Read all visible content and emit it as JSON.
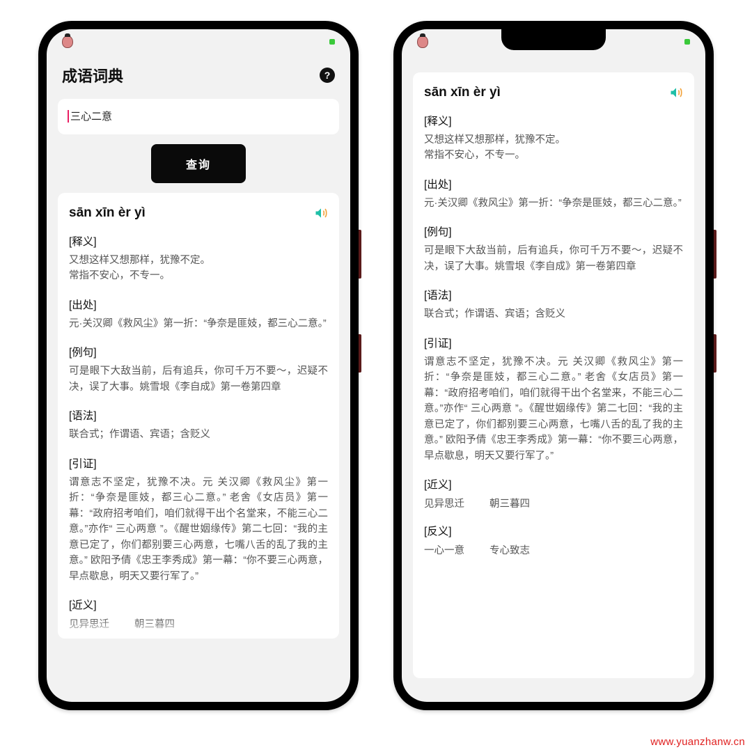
{
  "watermark": "www.yuanzhanw.cn",
  "left": {
    "app_title": "成语词典",
    "search_value": "三心二意",
    "query_label": "查询",
    "pinyin": "sān xīn èr yì",
    "sections": {
      "def_label": "[释义]",
      "def_body": "又想这样又想那样，犹豫不定。\n常指不安心，不专一。",
      "src_label": "[出处]",
      "src_body": "元·关汉卿《救风尘》第一折：“争奈是匪妓，都三心二意。”",
      "ex_label": "[例句]",
      "ex_body": "可是眼下大敌当前，后有追兵，你可千万不要～，迟疑不决，误了大事。姚雪垠《李自成》第一卷第四章",
      "gram_label": "[语法]",
      "gram_body": "联合式；作谓语、宾语；含贬义",
      "cite_label": "[引证]",
      "cite_body": "谓意志不坚定，犹豫不决。元 关汉卿《救风尘》第一折：“争奈是匪妓，都三心二意。” 老舍《女店员》第一幕：“政府招考咱们，咱们就得干出个名堂来，不能三心二意。”亦作“ 三心两意 ”。《醒世姻缘传》第二七回：“我的主意已定了，你们都别要三心两意，七嘴八舌的乱了我的主意。” 欧阳予倩《忠王李秀成》第一幕：“你不要三心两意，早点歇息，明天又要行军了。”",
      "syn_label": "[近义]",
      "syn_words": [
        "见异思迁",
        "朝三暮四"
      ]
    }
  },
  "right": {
    "pinyin": "sān xīn èr yì",
    "sections": {
      "def_label": "[释义]",
      "def_body": "又想这样又想那样，犹豫不定。\n常指不安心，不专一。",
      "src_label": "[出处]",
      "src_body": "元·关汉卿《救风尘》第一折：“争奈是匪妓，都三心二意。”",
      "ex_label": "[例句]",
      "ex_body": "可是眼下大敌当前，后有追兵，你可千万不要～，迟疑不决，误了大事。姚雪垠《李自成》第一卷第四章",
      "gram_label": "[语法]",
      "gram_body": "联合式；作谓语、宾语；含贬义",
      "cite_label": "[引证]",
      "cite_body": "谓意志不坚定，犹豫不决。元 关汉卿《救风尘》第一折：“争奈是匪妓，都三心二意。” 老舍《女店员》第一幕：“政府招考咱们，咱们就得干出个名堂来，不能三心二意。”亦作“ 三心两意 ”。《醒世姻缘传》第二七回：“我的主意已定了，你们都别要三心两意，七嘴八舌的乱了我的主意。” 欧阳予倩《忠王李秀成》第一幕：“你不要三心两意，早点歇息，明天又要行军了。”",
      "syn_label": "[近义]",
      "syn_words": [
        "见异思迁",
        "朝三暮四"
      ],
      "ant_label": "[反义]",
      "ant_words": [
        "一心一意",
        "专心致志"
      ]
    }
  }
}
